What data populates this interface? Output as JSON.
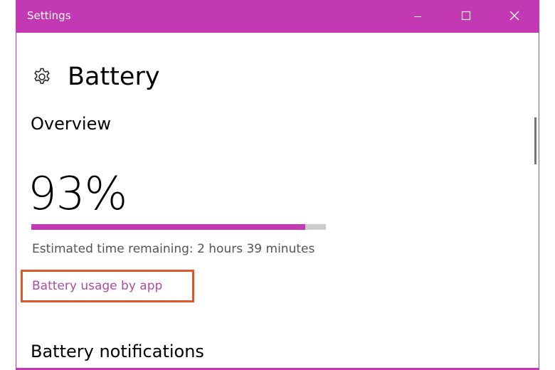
{
  "window": {
    "title": "Settings",
    "accent_color": "#c239b3"
  },
  "titlebar": {
    "minimize_icon": "minimize-icon",
    "maximize_icon": "maximize-icon",
    "close_icon": "close-icon"
  },
  "page": {
    "icon": "gear-icon",
    "title": "Battery"
  },
  "overview": {
    "heading": "Overview",
    "percentage_text": "93%",
    "charge_fraction": 0.93,
    "estimated_time": "Estimated time remaining: 2 hours 39 minutes",
    "usage_link": "Battery usage by app",
    "highlight_color": "#e0552a"
  },
  "notifications": {
    "heading": "Battery notifications"
  }
}
